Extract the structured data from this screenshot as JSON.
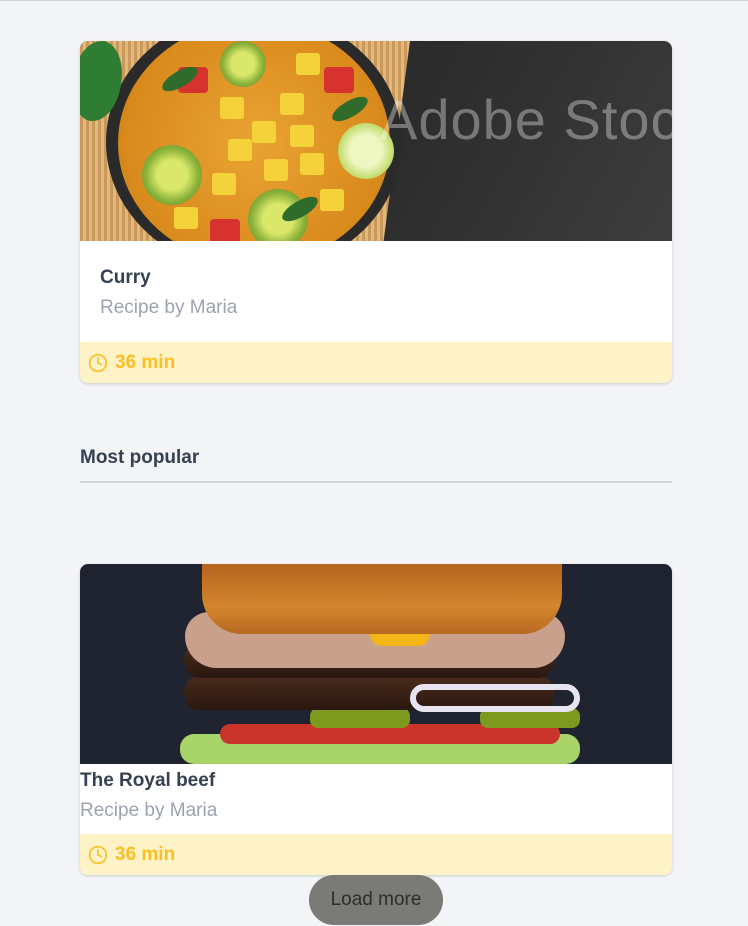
{
  "cards": [
    {
      "title": "Curry",
      "subtitle": "Recipe by Maria",
      "time": "36 min",
      "image_alt": "curry-image",
      "watermark": "Adobe Stock"
    },
    {
      "title": "The Royal beef",
      "subtitle": "Recipe by Maria",
      "time": "36 min",
      "image_alt": "burger-image"
    }
  ],
  "section": {
    "title": "Most popular"
  },
  "load_more_label": "Load more",
  "colors": {
    "background": "#f3f4f6",
    "footer_bg": "#fef3c7",
    "footer_text": "#fbbf24",
    "title_text": "#374151",
    "subtitle_text": "#9ca3af",
    "button_bg": "#7a7b76"
  },
  "icons": {
    "time": "clock-icon"
  }
}
